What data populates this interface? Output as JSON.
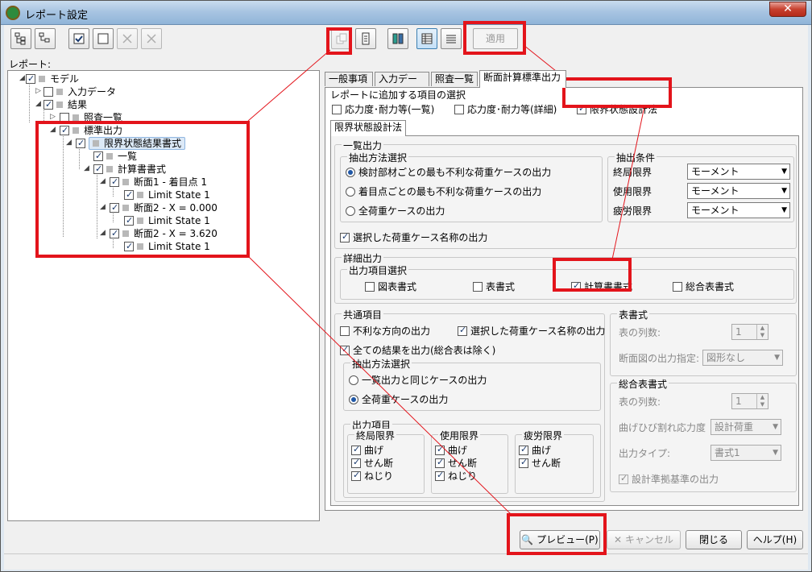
{
  "window": {
    "title": "レポート設定",
    "close_glyph": "✕"
  },
  "toolbar": {
    "apply_label": "適用"
  },
  "tree": {
    "label": "レポート:",
    "nodes": {
      "model": "モデル",
      "input_data": "入力データ",
      "results": "結果",
      "check_list": "照査一覧",
      "standard_output": "標準出力",
      "limit_state_format": "限界状態結果書式",
      "summary": "一覧",
      "calc_format": "計算書書式",
      "section1": "断面1 - 着目点  1",
      "section1_ls": "Limit State 1",
      "section2": "断面2 - X = 0.000",
      "section2_ls": "Limit State 1",
      "section3": "断面2 - X = 3.620",
      "section3_ls": "Limit State 1"
    }
  },
  "tabs": {
    "general": "一般事項",
    "input": "入力データ",
    "check": "照査一覧",
    "section_std": "断面計算標準出力"
  },
  "report_items": {
    "title": "レポートに追加する項目の選択",
    "stress_list": "応力度･耐力等(一覧)",
    "stress_detail": "応力度･耐力等(詳細)",
    "limit_state": "限界状態設計法"
  },
  "inner_tab": "限界状態設計法",
  "list_output": {
    "title": "一覧出力",
    "method_title": "抽出方法選択",
    "opt1": "検討部材ごとの最も不利な荷重ケースの出力",
    "opt2": "着目点ごとの最も不利な荷重ケースの出力",
    "opt3": "全荷重ケースの出力",
    "cond_title": "抽出条件",
    "ultimate": "終局限界",
    "service": "使用限界",
    "fatigue": "疲労限界",
    "moment": "モーメント",
    "selected_case_name": "選択した荷重ケース名称の出力"
  },
  "detail_output": {
    "title": "詳細出力",
    "item_title": "出力項目選択",
    "figure_format": "図表書式",
    "table_format": "表書式",
    "calc_format": "計算書書式",
    "total_format": "総合表書式"
  },
  "common": {
    "title": "共通項目",
    "unfavorable_dir": "不利な方向の出力",
    "selected_case_name": "選択した荷重ケース名称の出力",
    "all_results": "全ての結果を出力(総合表は除く)",
    "method_title": "抽出方法選択",
    "same_as_list": "一覧出力と同じケースの出力",
    "all_cases": "全荷重ケースの出力",
    "out_items": "出力項目",
    "ultimate": "終局限界",
    "service": "使用限界",
    "fatigue": "疲労限界",
    "bending": "曲げ",
    "shear": "せん断",
    "torsion": "ねじり"
  },
  "table_fmt": {
    "title": "表書式",
    "columns": "表の列数:",
    "columns_value": "1",
    "section_view": "断面図の出力指定:",
    "section_view_value": "図形なし"
  },
  "total_fmt": {
    "title": "総合表書式",
    "columns": "表の列数:",
    "columns_value": "1",
    "crack_stress": "曲げひび割れ応力度",
    "crack_stress_value": "設計荷重",
    "output_type": "出力タイプ:",
    "output_type_value": "書式1",
    "design_basis": "設計準拠基準の出力"
  },
  "buttons": {
    "preview": "プレビュー(P)",
    "cancel": "キャンセル",
    "close": "閉じる",
    "help": "ヘルプ(H)"
  },
  "colors": {
    "highlight": "#e3141b"
  }
}
